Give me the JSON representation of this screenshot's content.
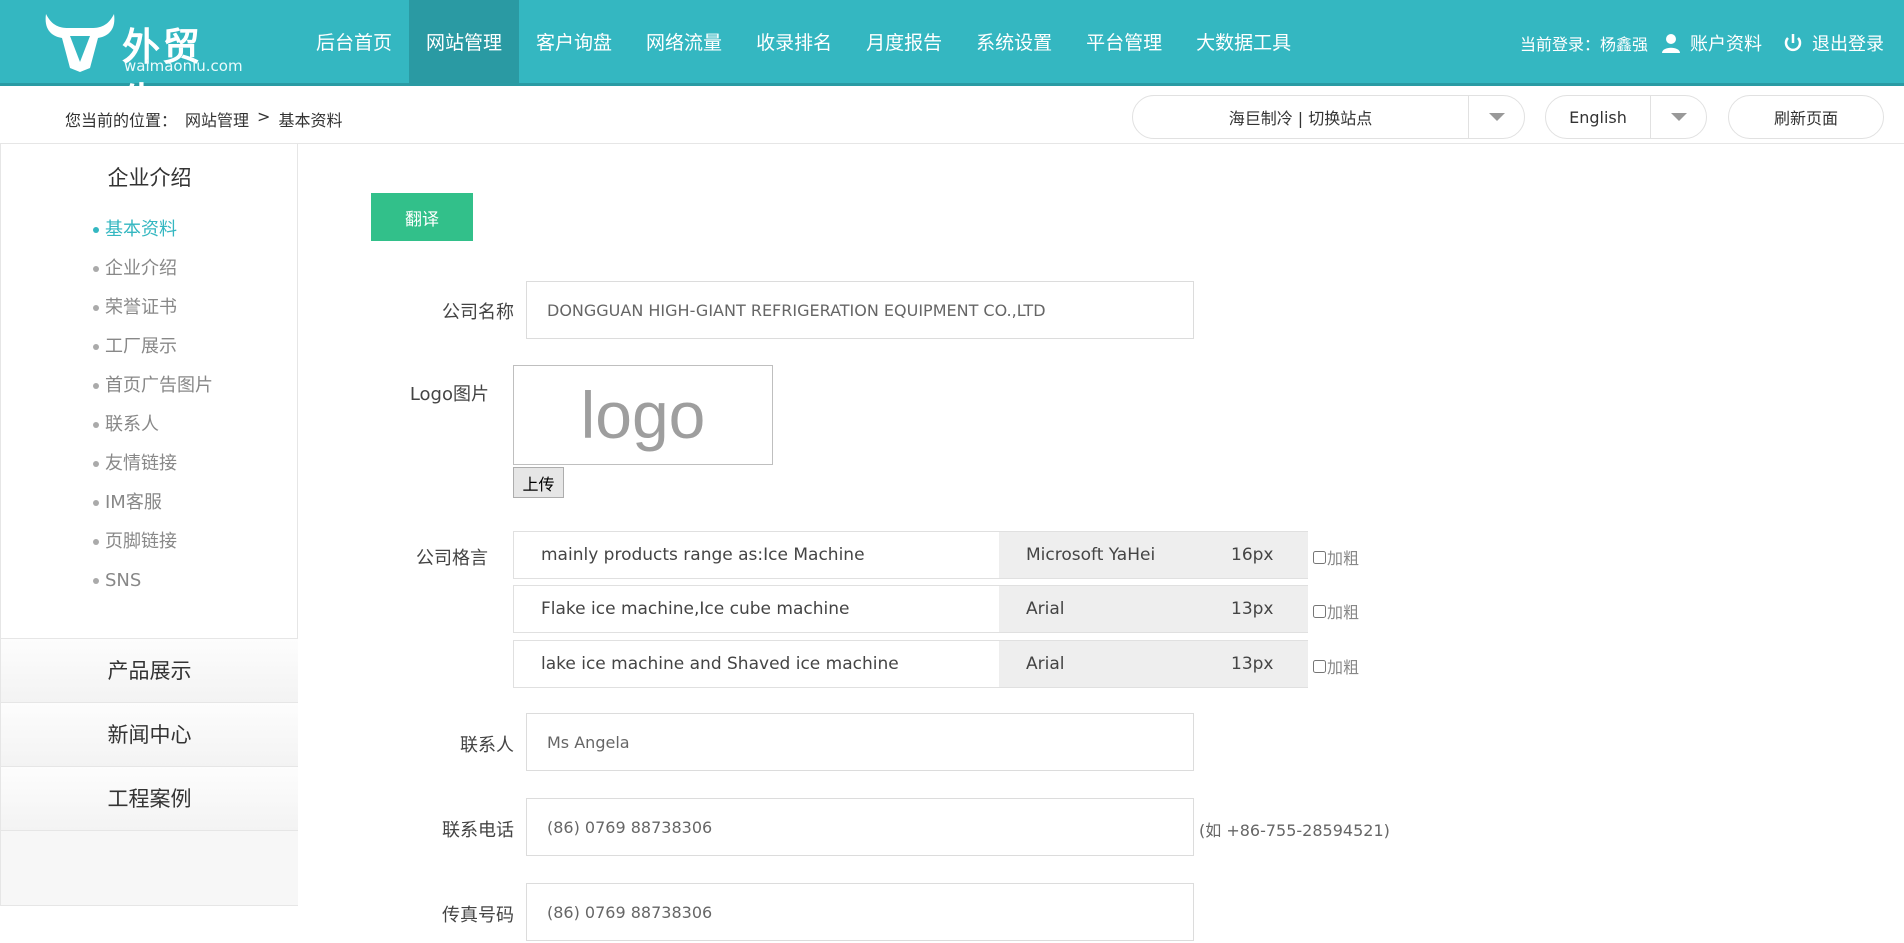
{
  "header": {
    "brand": "外贸牛",
    "domain": "waimaoniu.com",
    "nav": [
      {
        "label": "后台首页",
        "active": false
      },
      {
        "label": "网站管理",
        "active": true
      },
      {
        "label": "客户询盘",
        "active": false
      },
      {
        "label": "网络流量",
        "active": false
      },
      {
        "label": "收录排名",
        "active": false
      },
      {
        "label": "月度报告",
        "active": false
      },
      {
        "label": "系统设置",
        "active": false
      },
      {
        "label": "平台管理",
        "active": false
      },
      {
        "label": "大数据工具",
        "active": false
      }
    ],
    "login_text": "当前登录：杨鑫强",
    "account_label": "账户资料",
    "logout_label": "退出登录"
  },
  "breadcrumb": {
    "prefix": "您当前的位置：",
    "items": [
      "网站管理",
      ">",
      "基本资料"
    ]
  },
  "toolbar": {
    "site_switch": "海巨制冷 | 切换站点",
    "language": "English",
    "refresh": "刷新页面"
  },
  "sidebar": {
    "section_title": "企业介绍",
    "items": [
      {
        "label": "基本资料",
        "active": true
      },
      {
        "label": "企业介绍",
        "active": false
      },
      {
        "label": "荣誉证书",
        "active": false
      },
      {
        "label": "工厂展示",
        "active": false
      },
      {
        "label": "首页广告图片",
        "active": false
      },
      {
        "label": "联系人",
        "active": false
      },
      {
        "label": "友情链接",
        "active": false
      },
      {
        "label": "IM客服",
        "active": false
      },
      {
        "label": "页脚链接",
        "active": false
      },
      {
        "label": "SNS",
        "active": false
      }
    ],
    "blocks": [
      "产品展示",
      "新闻中心",
      "工程案例"
    ]
  },
  "form": {
    "translate_button": "翻译",
    "company_name_label": "公司名称",
    "company_name": "DONGGUAN HIGH-GIANT REFRIGERATION EQUIPMENT CO.,LTD",
    "logo_label": "Logo图片",
    "logo_text": "logo",
    "upload_button": "上传",
    "motto_label": "公司格言",
    "mottos": [
      {
        "text": "mainly products range as:Ice Machine",
        "font": "Microsoft YaHei",
        "size": "16px",
        "bold_label": "加粗"
      },
      {
        "text": "Flake ice machine,Ice cube machine",
        "font": "Arial",
        "size": "13px",
        "bold_label": "加粗"
      },
      {
        "text": "lake ice machine and Shaved ice machine",
        "font": "Arial",
        "size": "13px",
        "bold_label": "加粗"
      }
    ],
    "contact_label": "联系人",
    "contact": "Ms Angela",
    "phone_label": "联系电话",
    "phone": "(86) 0769 88738306",
    "phone_hint": "(如 +86-755-28594521)",
    "fax_label": "传真号码",
    "fax": "(86) 0769 88738306"
  },
  "colors": {
    "header_bg": "#34b7c1",
    "nav_active_bg": "#2a9aa3",
    "translate_button": "#32c08a",
    "sidebar_active": "#34b7c1"
  }
}
